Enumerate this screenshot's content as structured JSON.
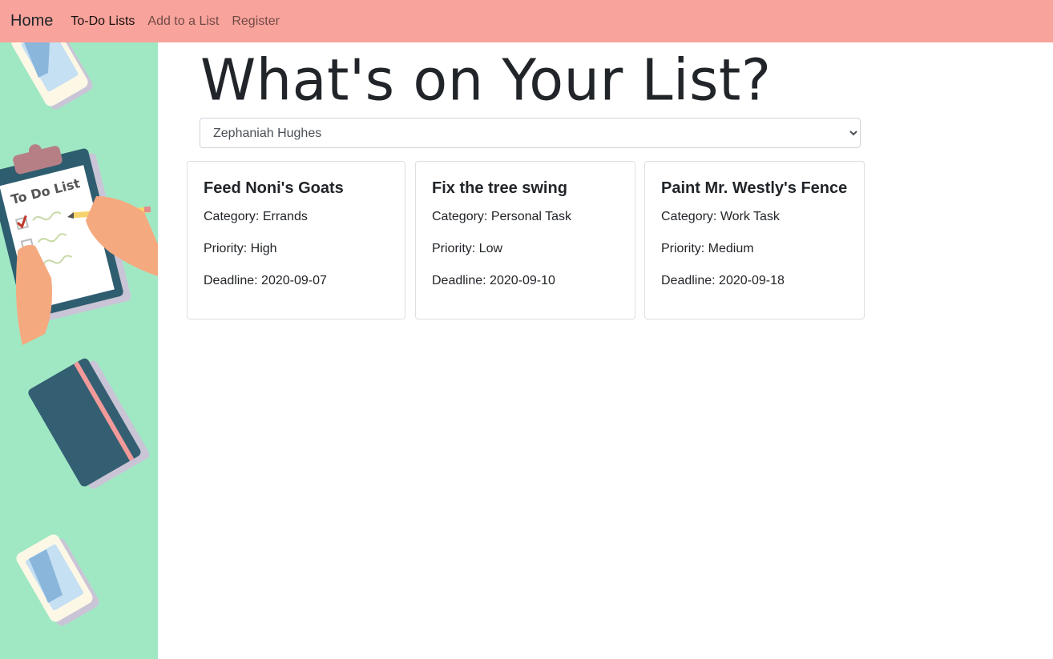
{
  "nav": {
    "brand": "Home",
    "links": [
      {
        "label": "To-Do Lists",
        "active": true
      },
      {
        "label": "Add to a List",
        "active": false
      },
      {
        "label": "Register",
        "active": false
      }
    ]
  },
  "sidebar": {
    "illustration_text": "To Do List",
    "icons": [
      "phone-icon",
      "clipboard-todo-icon",
      "notebook-icon",
      "phone-icon"
    ]
  },
  "main": {
    "heading": "What's on Your List?",
    "list_select": {
      "selected": "Zephaniah Hughes"
    },
    "cards": [
      {
        "title": "Feed Noni's Goats",
        "category": "Category: Errands",
        "priority": "Priority: High",
        "deadline": "Deadline: 2020-09-07"
      },
      {
        "title": "Fix the tree swing",
        "category": "Category: Personal Task",
        "priority": "Priority: Low",
        "deadline": "Deadline: 2020-09-10"
      },
      {
        "title": "Paint Mr. Westly's Fence",
        "category": "Category: Work Task",
        "priority": "Priority: Medium",
        "deadline": "Deadline: 2020-09-18"
      }
    ]
  },
  "colors": {
    "navbar": "#f8a39b",
    "sidebar": "#a0e8c4",
    "card_border": "#dfdfdf"
  }
}
